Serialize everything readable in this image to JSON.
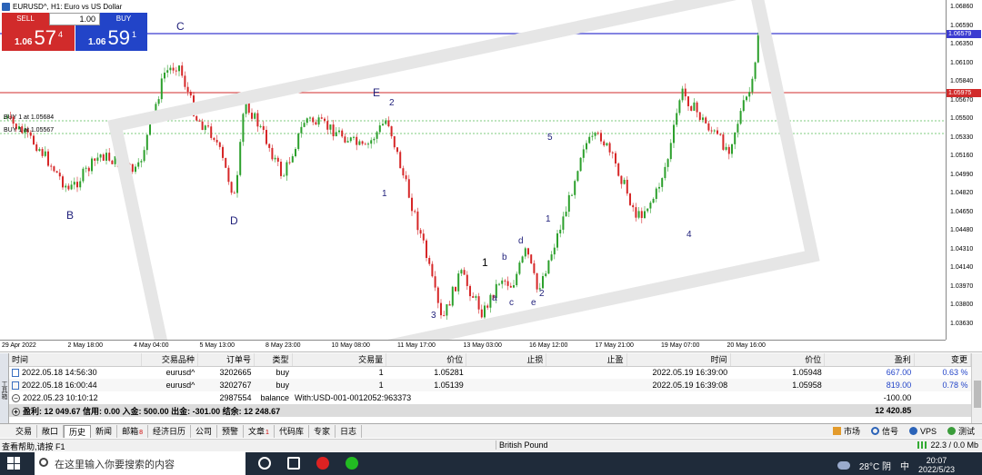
{
  "window": {
    "title": "EURUSD^, H1: Euro vs US Dollar"
  },
  "trade_panel": {
    "sell_label": "SELL",
    "buy_label": "BUY",
    "lot": "1.00",
    "sell_small": "1.06",
    "sell_big": "57",
    "sell_sup": "4",
    "buy_small": "1.06",
    "buy_big": "59",
    "buy_sup": "1"
  },
  "chart": {
    "buy_line_1": "BUY 1 at 1.05684",
    "buy_line_2": "BUY 1 at 1.05567",
    "level_blue": "1.06579",
    "level_red": "1.05975",
    "price_labels": [
      "1.06860",
      "1.06590",
      "1.06350",
      "1.06100",
      "1.05840",
      "1.05670",
      "1.05500",
      "1.05330",
      "1.05160",
      "1.04990",
      "1.04820",
      "1.04650",
      "1.04480",
      "1.04310",
      "1.04140",
      "1.03970",
      "1.03800",
      "1.03630"
    ],
    "time_labels": [
      "29 Apr 2022",
      "2 May 18:00",
      "4 May 04:00",
      "5 May 13:00",
      "8 May 23:00",
      "10 May 08:00",
      "11 May 17:00",
      "13 May 03:00",
      "16 May 12:00",
      "17 May 21:00",
      "19 May 07:00",
      "20 May 16:00"
    ],
    "waves": {
      "C": "C",
      "B": "B",
      "D": "D",
      "E": "E",
      "w2": "2",
      "w1a": "1",
      "w1b": "1",
      "w3": "3",
      "wa": "a",
      "wb": "b",
      "wc": "c",
      "wd": "d",
      "we": "e",
      "w2b": "2",
      "w1c": "1",
      "w5": "5",
      "w4": "4"
    }
  },
  "terminal": {
    "side_label": "工具箱",
    "headers": {
      "time": "时间",
      "symbol": "交易品种",
      "order": "订单号",
      "type": "类型",
      "volume": "交易量",
      "price": "价位",
      "sl": "止损",
      "tp": "止盈",
      "close_time": "时间",
      "close_price": "价位",
      "profit": "盈利",
      "change": "变更"
    },
    "rows": [
      {
        "time": "2022.05.18 14:56:30",
        "symbol": "eurusd^",
        "order": "3202665",
        "type": "buy",
        "volume": "1",
        "price": "1.05281",
        "close_time": "2022.05.19 16:39:00",
        "close_price": "1.05948",
        "profit": "667.00",
        "change": "0.63 %"
      },
      {
        "time": "2022.05.18 16:00:44",
        "symbol": "eurusd^",
        "order": "3202767",
        "type": "buy",
        "volume": "1",
        "price": "1.05139",
        "close_time": "2022.05.19 16:39:08",
        "close_price": "1.05958",
        "profit": "819.00",
        "change": "0.78 %"
      }
    ],
    "balance_row": {
      "time": "2022.05.23 10:10:12",
      "order": "2987554",
      "type": "balance",
      "comment": "With:USD-001-0012052:963373",
      "profit": "-100.00"
    },
    "summary": {
      "text": "盈利: 12 049.67  信用: 0.00  入金: 500.00  出金: -301.00  结余: 12 248.67",
      "total": "12 420.85"
    }
  },
  "tabs": [
    {
      "label": "交易"
    },
    {
      "label": "敞口"
    },
    {
      "label": "历史"
    },
    {
      "label": "新闻"
    },
    {
      "label": "邮箱",
      "badge": "8"
    },
    {
      "label": "经济日历"
    },
    {
      "label": "公司"
    },
    {
      "label": "预警"
    },
    {
      "label": "文章",
      "badge": "1"
    },
    {
      "label": "代码库"
    },
    {
      "label": "专家"
    },
    {
      "label": "日志"
    }
  ],
  "tabs_right": {
    "market": "市场",
    "signals": "信号",
    "vps": "VPS",
    "tester": "测试"
  },
  "statusbar": {
    "help": "查看帮助,请按 F1",
    "profile": "British Pound",
    "traffic": "22.3 / 0.0 Mb"
  },
  "taskbar": {
    "search_placeholder": "在这里输入你要搜索的内容",
    "weather": "28°C 阴",
    "ime": "中",
    "time": "20:07",
    "date": "2022/5/23"
  },
  "colors": {
    "bull": "#2ca02c",
    "bear": "#d62728",
    "sell": "#d12b2b",
    "buy": "#2244c8"
  }
}
